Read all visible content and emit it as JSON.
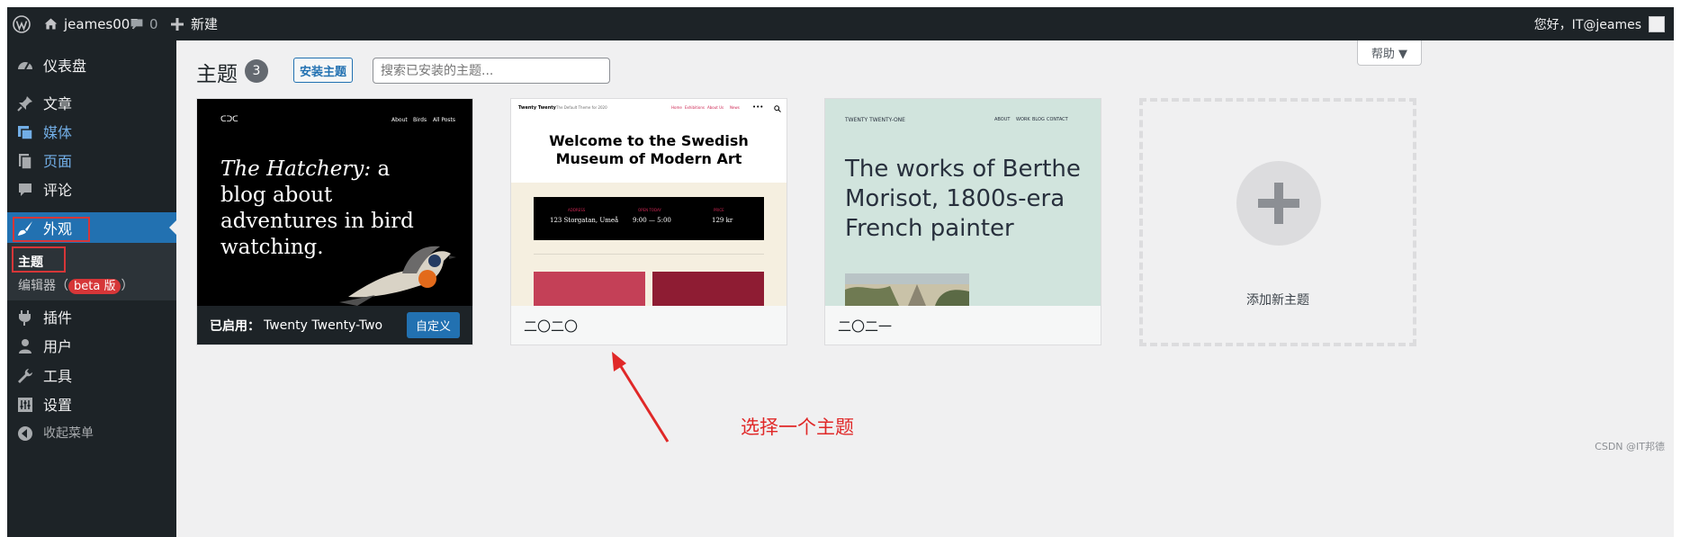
{
  "admin_bar": {
    "site_name": "jeames007",
    "comments_count": "0",
    "new_label": "新建",
    "greeting": "您好，IT@jeames"
  },
  "sidebar": {
    "items": [
      {
        "label": "仪表盘",
        "icon": "dashboard-icon"
      },
      {
        "label": "文章",
        "icon": "pin-icon"
      },
      {
        "label": "媒体",
        "icon": "media-icon"
      },
      {
        "label": "页面",
        "icon": "page-icon"
      },
      {
        "label": "评论",
        "icon": "comment-icon"
      },
      {
        "label": "外观",
        "icon": "brush-icon"
      },
      {
        "label": "插件",
        "icon": "plugin-icon"
      },
      {
        "label": "用户",
        "icon": "user-icon"
      },
      {
        "label": "工具",
        "icon": "wrench-icon"
      },
      {
        "label": "设置",
        "icon": "settings-icon"
      },
      {
        "label": "收起菜单",
        "icon": "collapse-icon"
      }
    ],
    "submenu": {
      "themes": "主题",
      "editor": "编辑器（",
      "beta_badge": "beta 版",
      "editor_close": "）"
    }
  },
  "main": {
    "title": "主题",
    "count": "3",
    "install_button": "安装主题",
    "search_placeholder": "搜索已安装的主题...",
    "help_label": "帮助 ▼"
  },
  "themes": [
    {
      "active_label": "已启用：",
      "name": "Twenty Twenty-Two",
      "customize_button": "自定义",
      "preview": {
        "logo": "ᑕᑐᑕ",
        "nav": [
          "About",
          "Birds",
          "All Posts"
        ],
        "heading_italic": "The Hatchery:",
        "heading_rest": " a blog about adventures in bird watching."
      }
    },
    {
      "name": "二〇二〇",
      "preview": {
        "site_title": "Twenty Twenty",
        "tagline": "The Default Theme for 2020",
        "nav": [
          "Home",
          "Exhibitions",
          "About Us",
          "News"
        ],
        "heading": "Welcome to the Swedish Museum of Modern Art",
        "info_labels": [
          "ADDRESS",
          "OPEN TODAY",
          "PRICE"
        ],
        "info_values": [
          "123 Storgatan, Umeå",
          "9:00 — 5:00",
          "129 kr"
        ]
      }
    },
    {
      "name": "二〇二一",
      "preview": {
        "site_title": "TWENTY TWENTY-ONE",
        "nav": [
          "ABOUT",
          "WORK",
          "BLOG",
          "CONTACT"
        ],
        "heading": "The works of Berthe Morisot, 1800s-era French painter"
      }
    }
  ],
  "add_new_theme": "添加新主题",
  "annotation": "选择一个主题",
  "watermark": "CSDN @IT邦德",
  "colors": {
    "admin_dark": "#1d2327",
    "accent_blue": "#2271b1",
    "annotation_red": "#d63638"
  }
}
